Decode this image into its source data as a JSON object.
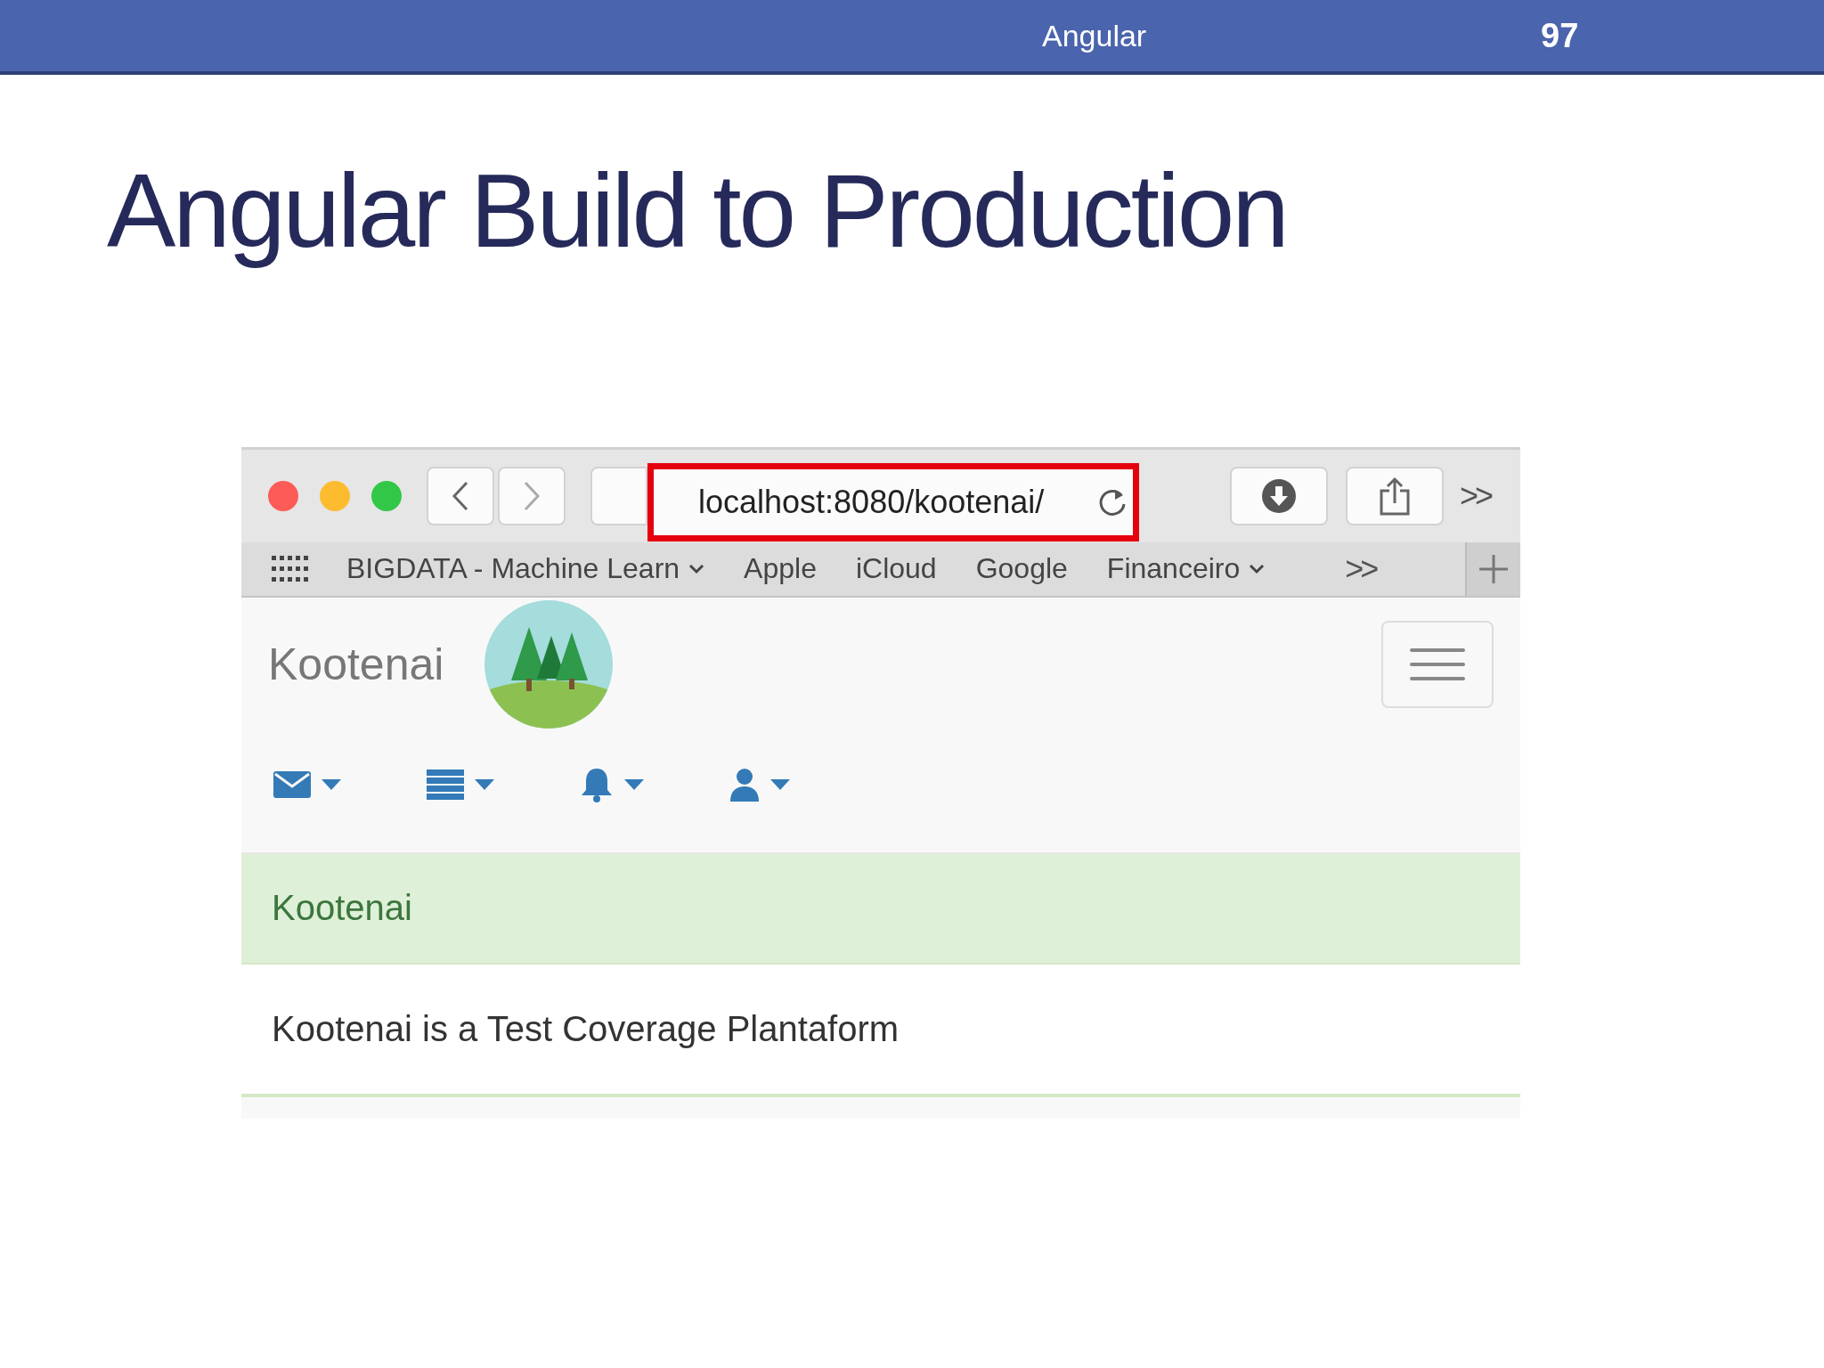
{
  "header": {
    "topic": "Angular",
    "page": "97"
  },
  "title": "Angular Build to Production",
  "browser": {
    "url": "localhost:8080/kootenai/",
    "toolbar_overflow": ">>",
    "bookmarks_overflow": ">>",
    "bookmarks": [
      {
        "label": "BIGDATA - Machine Learn",
        "dropdown": true
      },
      {
        "label": "Apple",
        "dropdown": false
      },
      {
        "label": "iCloud",
        "dropdown": false
      },
      {
        "label": "Google",
        "dropdown": false
      },
      {
        "label": "Financeiro",
        "dropdown": true
      }
    ]
  },
  "app": {
    "brand": "Kootenai",
    "panel_heading": "Kootenai",
    "panel_body": "Kootenai is a Test Coverage Plantaform"
  }
}
